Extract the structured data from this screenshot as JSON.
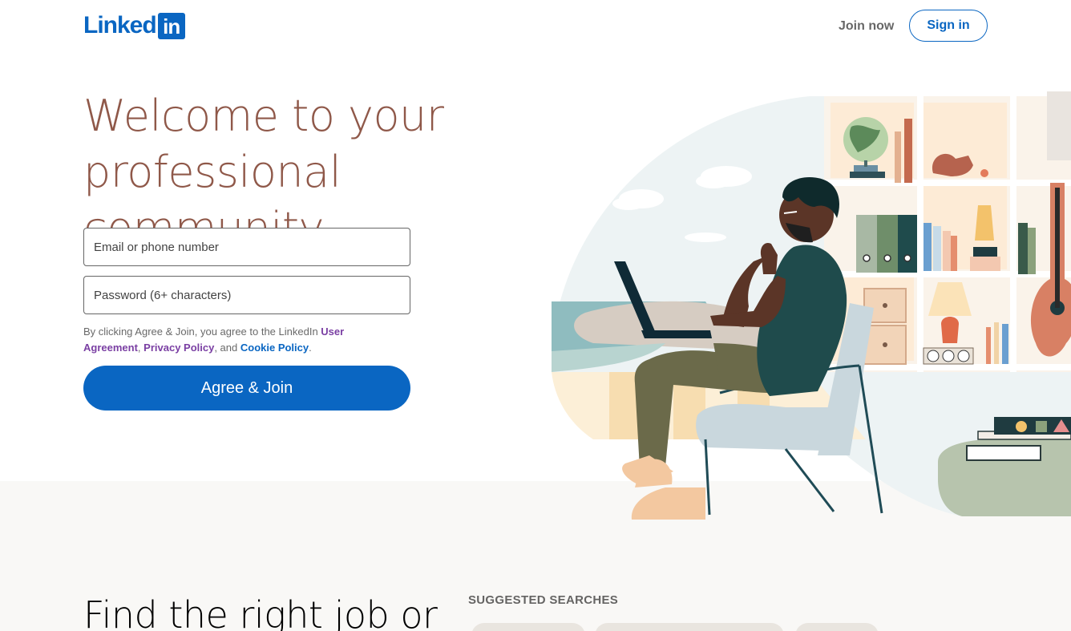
{
  "header": {
    "logo_text": "Linked",
    "logo_box": "in",
    "join_now": "Join now",
    "sign_in": "Sign in"
  },
  "hero": {
    "title_line1": "Welcome to your",
    "title_line2": "professional community"
  },
  "form": {
    "email_placeholder": "Email or phone number",
    "password_placeholder": "Password (6+ characters)",
    "legal_prefix": "By clicking Agree & Join, you agree to the LinkedIn ",
    "user_agreement": "User Agreement",
    "sep1": ", ",
    "privacy_policy": "Privacy Policy",
    "sep2": ", and ",
    "cookie_policy": "Cookie Policy",
    "legal_suffix": ".",
    "agree_button": "Agree & Join"
  },
  "lower": {
    "find_title": "Find the right job or",
    "suggested_searches": "SUGGESTED SEARCHES"
  },
  "colors": {
    "brand_blue": "#0a66c2",
    "hero_title": "#8f5849",
    "link_purple": "#7a3fa3",
    "band_background": "#f9f8f6"
  }
}
